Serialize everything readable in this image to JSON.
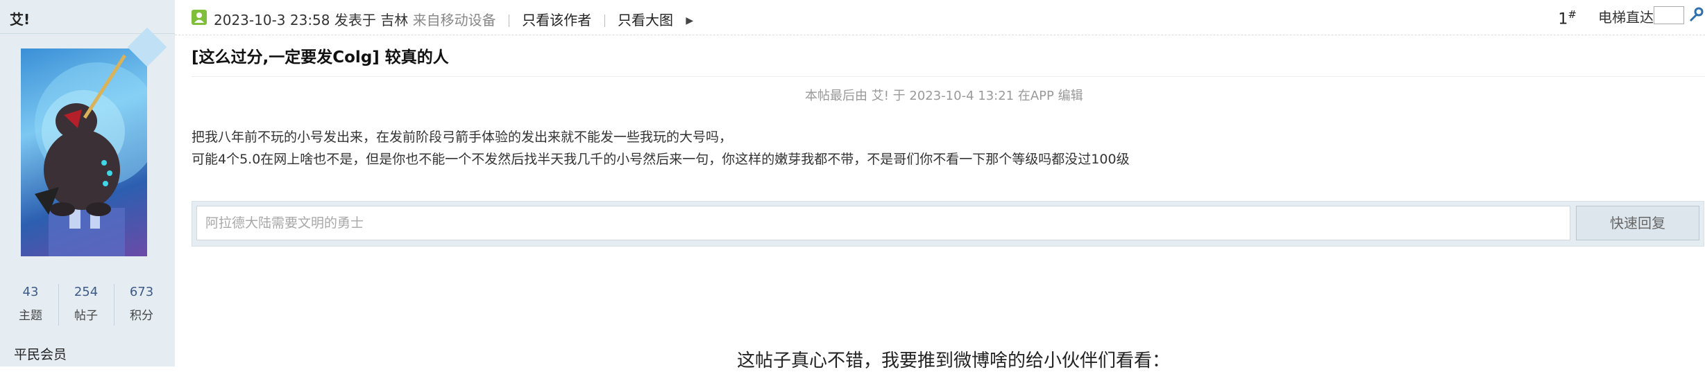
{
  "user": {
    "name": "艾!",
    "stats": [
      {
        "value": "43",
        "label": "主题"
      },
      {
        "value": "254",
        "label": "帖子"
      },
      {
        "value": "673",
        "label": "积分"
      }
    ],
    "level": "平民会员"
  },
  "post": {
    "posted_at": "2023-10-3 23:58",
    "posted_word": "发表于",
    "location": "吉林",
    "device": "来自移动设备",
    "only_author": "只看该作者",
    "only_big_images": "只看大图",
    "floor_number": "1",
    "floor_mark": "#",
    "elevator_label": "电梯直达",
    "title": "[这么过分,一定要发Colg] 较真的人",
    "edit_note": "本帖最后由 艾!  于 2023-10-4 13:21 在APP 编辑",
    "body_lines": [
      "把我八年前不玩的小号发出来，在发前阶段弓箭手体验的发出来就不能发一些我玩的大号吗，",
      "可能4个5.0在网上啥也不是，但是你也不能一个不发然后找半天我几千的小号然后来一句，你这样的嫩芽我都不带，不是哥们你不看一下那个等级吗都没过100级"
    ]
  },
  "quick_reply": {
    "placeholder": "阿拉德大陆需要文明的勇士",
    "button_label": "快速回复"
  },
  "share": {
    "text": "这帖子真心不错，我要推到微博啥的给小伙伴们看看："
  },
  "icons": {
    "author": "user-icon",
    "dropdown": "triangle-right-icon",
    "go": "wrench-icon"
  }
}
